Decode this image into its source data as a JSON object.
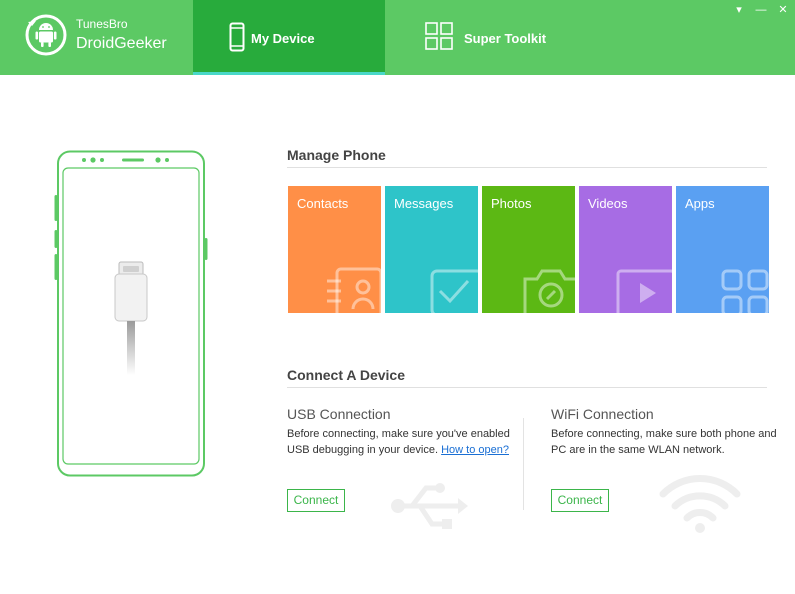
{
  "brand": {
    "small": "TunesBro",
    "big": "DroidGeeker"
  },
  "tabs": [
    {
      "label": "My Device",
      "icon": "phone-icon",
      "active": true
    },
    {
      "label": "Super Toolkit",
      "icon": "grid-icon",
      "active": false
    }
  ],
  "window_controls": {
    "menu": "▾",
    "minimize": "—",
    "close": "✕"
  },
  "manage": {
    "title": "Manage Phone",
    "tiles": [
      {
        "label": "Contacts",
        "icon": "contacts-icon",
        "color": "#ff8f47"
      },
      {
        "label": "Messages",
        "icon": "messages-icon",
        "color": "#2ec4c9"
      },
      {
        "label": "Photos",
        "icon": "camera-icon",
        "color": "#5cb814"
      },
      {
        "label": "Videos",
        "icon": "video-icon",
        "color": "#a76ce4"
      },
      {
        "label": "Apps",
        "icon": "apps-icon",
        "color": "#5aa0f2"
      }
    ]
  },
  "connect": {
    "title": "Connect A Device",
    "usb": {
      "title": "USB Connection",
      "desc_line1": "Before connecting, make sure you've enabled",
      "desc_line2": "USB debugging in your device.",
      "link": "How to open?",
      "button": "Connect"
    },
    "wifi": {
      "title": "WiFi Connection",
      "desc_line1": "Before connecting, make sure both phone and",
      "desc_line2": "PC are in the same WLAN network.",
      "button": "Connect"
    }
  },
  "colors": {
    "header": "#5cc964",
    "active_tab": "#28ab3c",
    "tab_underline": "#49d8c8",
    "accent": "#3bb54a"
  }
}
